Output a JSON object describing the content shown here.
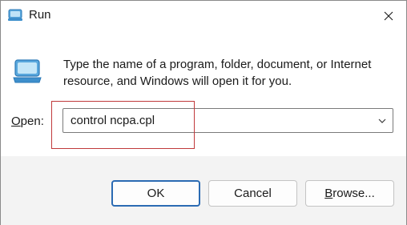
{
  "window": {
    "title": "Run",
    "title_icon": "run-app-icon",
    "close_icon": "close-icon"
  },
  "dialog": {
    "icon": "run-app-icon",
    "description": "Type the name of a program, folder, document, or Internet resource, and Windows will open it for you.",
    "open_label_first": "O",
    "open_label_rest": "pen:",
    "open_value": "control ncpa.cpl",
    "dropdown_icon": "chevron-down-icon"
  },
  "buttons": {
    "ok": "OK",
    "cancel": "Cancel",
    "browse_first": "B",
    "browse_rest": "rowse..."
  },
  "colors": {
    "highlight": "#c0393b",
    "ok_border": "#2b6bb3",
    "footer_bg": "#f3f3f3"
  }
}
